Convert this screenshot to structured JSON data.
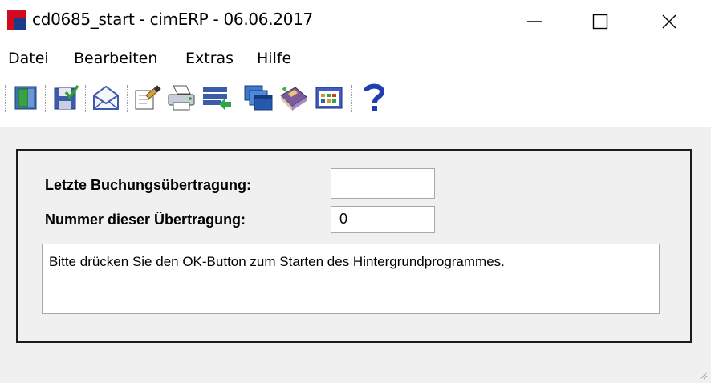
{
  "window": {
    "title": "cd0685_start  - cimERP - 06.06.2017",
    "controls": [
      "minimize",
      "maximize",
      "close"
    ]
  },
  "menu": [
    {
      "label": "Datei"
    },
    {
      "label": "Bearbeiten"
    },
    {
      "label": "Extras"
    },
    {
      "label": "Hilfe"
    }
  ],
  "toolbar": {
    "buttons": [
      {
        "icon": "exit-door-icon"
      },
      {
        "icon": "save-check-icon"
      },
      {
        "icon": "mail-envelope-icon"
      },
      {
        "icon": "properties-edit-icon"
      },
      {
        "icon": "printer-icon"
      },
      {
        "icon": "list-transfer-icon"
      },
      {
        "icon": "windows-stack-icon"
      },
      {
        "icon": "book-icon"
      },
      {
        "icon": "table-grid-icon"
      },
      {
        "icon": "help-question-icon"
      }
    ]
  },
  "form": {
    "last_transfer_label": "Letzte Buchungsübertragung:",
    "last_transfer_value": "",
    "transfer_number_label": "Nummer dieser Übertragung:",
    "transfer_number_value": "0",
    "message": "Bitte drücken Sie den OK-Button zum Starten des Hintergrundprogrammes."
  },
  "colors": {
    "accent_red": "#d10a1e",
    "accent_blue": "#1a3b8a",
    "client_bg": "#f0f0f0"
  }
}
